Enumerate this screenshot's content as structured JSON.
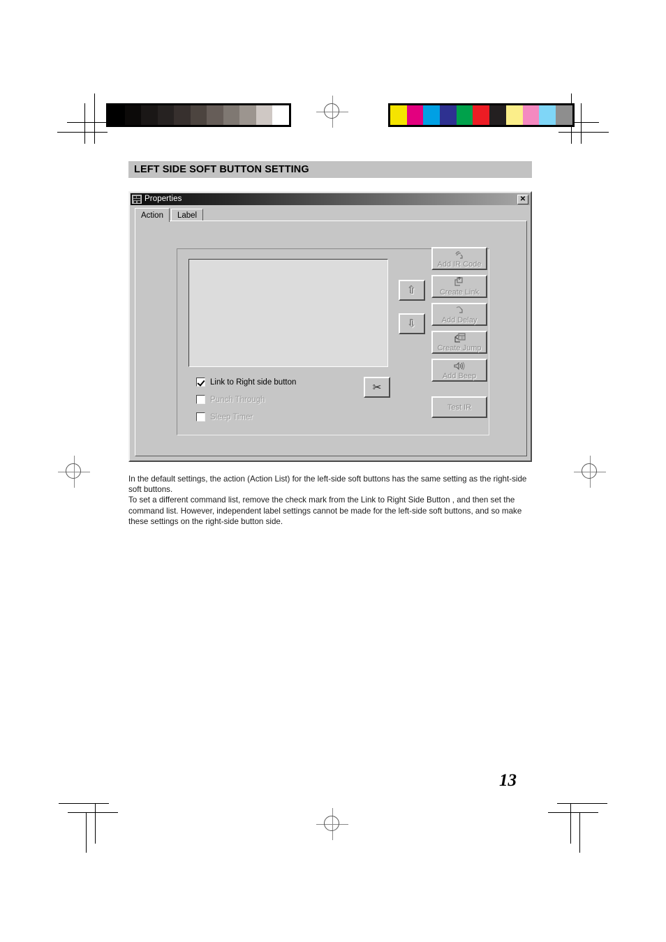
{
  "page": {
    "section_title": "LEFT SIDE SOFT BUTTON SETTING",
    "page_number": "13"
  },
  "dialog": {
    "title": "Properties",
    "title_icon": "application-icon",
    "close_label": "✕",
    "tabs": [
      {
        "label": "Action",
        "active": true
      },
      {
        "label": "Label",
        "active": false
      }
    ],
    "list": {
      "items": []
    },
    "move_buttons": [
      {
        "name": "move-up-button",
        "glyph": "⇧"
      },
      {
        "name": "move-down-button",
        "glyph": "⇩"
      }
    ],
    "cut_button": {
      "label": "✂",
      "name": "cut-button"
    },
    "action_buttons": [
      {
        "label": "Add IR Code",
        "icon": "ir-signal-icon",
        "enabled": false
      },
      {
        "label": "Create Link",
        "icon": "link-arrows-icon",
        "enabled": false
      },
      {
        "label": "Add Delay",
        "icon": "delay-clock-icon",
        "enabled": false
      },
      {
        "label": "Create Jump",
        "icon": "jump-window-icon",
        "enabled": false
      },
      {
        "label": "Add Beep",
        "icon": "speaker-icon",
        "enabled": false
      }
    ],
    "test_button": {
      "label": "Test IR",
      "enabled": false
    },
    "checkboxes": [
      {
        "label": "Link to Right side button",
        "checked": true,
        "enabled": true
      },
      {
        "label": "Punch Through",
        "checked": false,
        "enabled": false
      },
      {
        "label": "Sleep Timer",
        "checked": false,
        "enabled": false
      }
    ]
  },
  "body": {
    "paragraph1": "In the default settings, the action (Action List) for the left-side soft buttons has the same setting as the right-side soft buttons.",
    "paragraph2": "To set a different command list, remove the check mark from the  Link to Right Side Button , and then set the command list. However, independent label settings cannot be made for the left-side soft buttons, and so make these settings on the right-side button side."
  },
  "print_marks": {
    "grayscale_bar": [
      "#000000",
      "#0c0a09",
      "#1a1716",
      "#262221",
      "#37302e",
      "#4c443f",
      "#665d58",
      "#7f7872",
      "#9c958f",
      "#cfc8c4",
      "#ffffff"
    ],
    "color_bar": [
      "#f5e400",
      "#e3007f",
      "#00a0e4",
      "#2e3191",
      "#00a14b",
      "#ed1c24",
      "#231f20",
      "#fbee8a",
      "#f489c0",
      "#7fd6f7",
      "#8e8e8e"
    ]
  }
}
